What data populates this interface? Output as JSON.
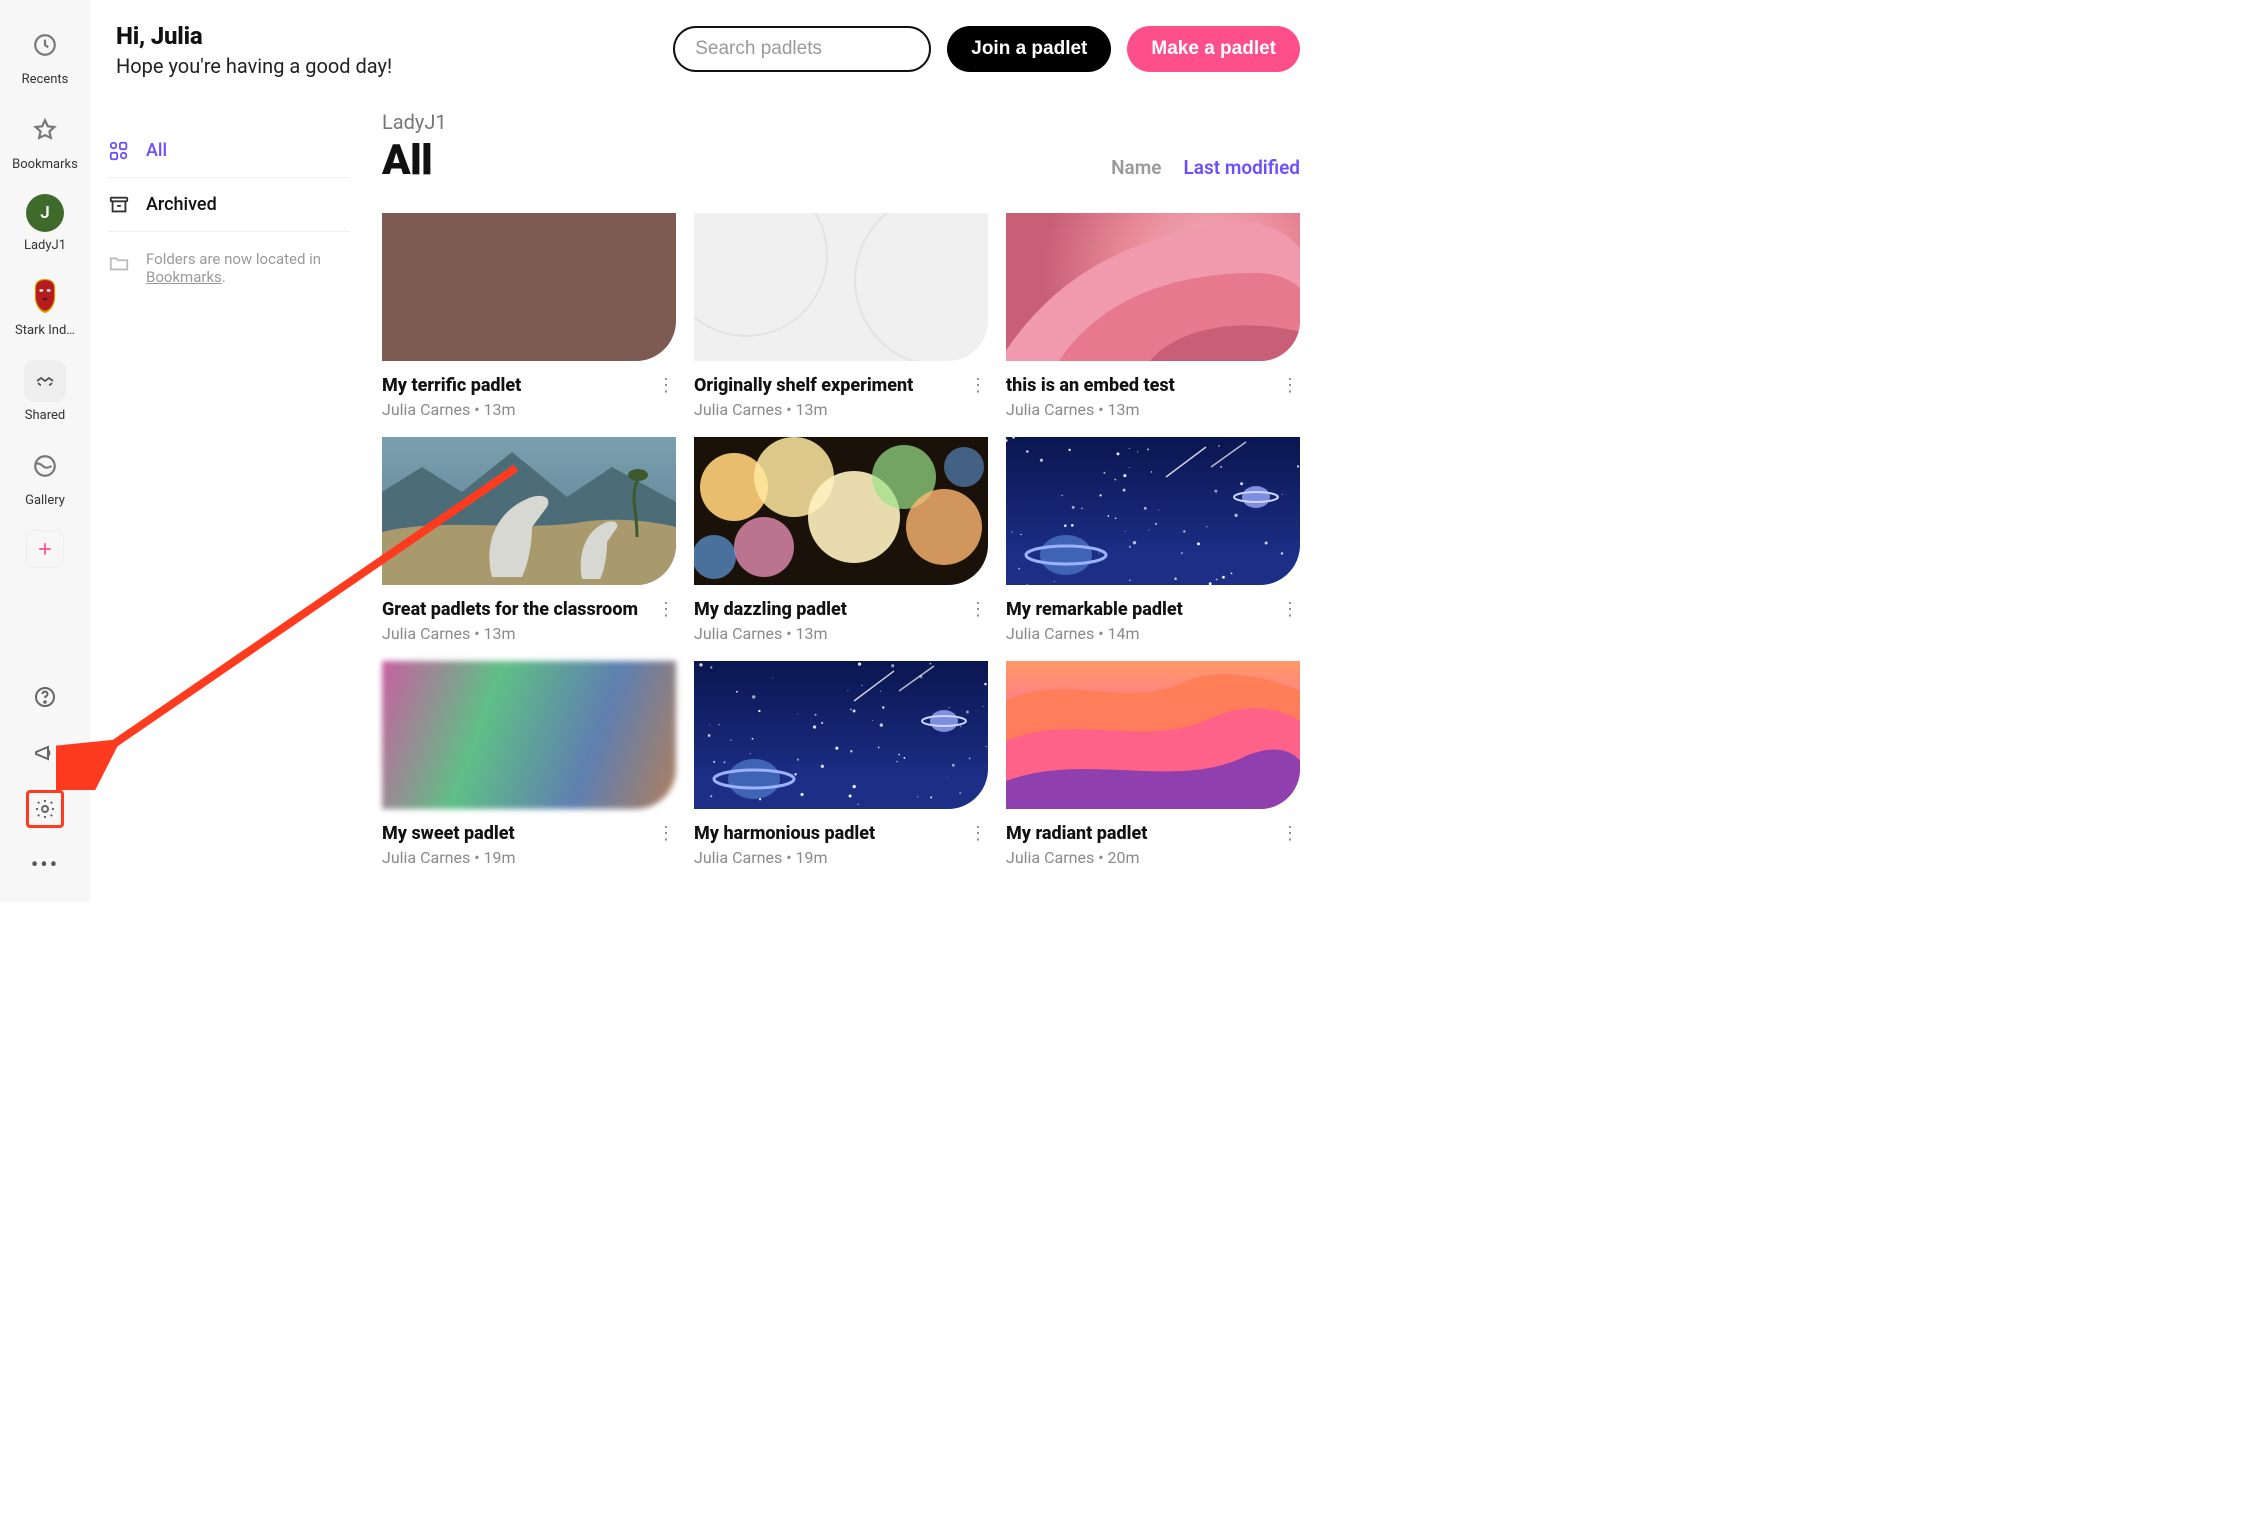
{
  "greet": {
    "hi": "Hi, Julia",
    "sub": "Hope you're having a good day!"
  },
  "search": {
    "placeholder": "Search padlets"
  },
  "buttons": {
    "join": "Join a padlet",
    "make": "Make a padlet"
  },
  "rail": {
    "recents": "Recents",
    "bookmarks": "Bookmarks",
    "ladyj": "LadyJ1",
    "ladyj_initial": "J",
    "stark": "Stark Ind…",
    "shared": "Shared",
    "gallery": "Gallery"
  },
  "nav2": {
    "all": "All",
    "archived": "Archived",
    "note1": "Folders are now located in ",
    "note_link": "Bookmarks",
    "note_period": "."
  },
  "breadcrumb": "LadyJ1",
  "heading": "All",
  "sort": {
    "name": "Name",
    "modified": "Last modified"
  },
  "cards": [
    {
      "title": "My terrific padlet",
      "meta": "Julia Carnes • 13m",
      "thumb": "brown"
    },
    {
      "title": "Originally shelf experiment",
      "meta": "Julia Carnes • 13m",
      "thumb": "gray"
    },
    {
      "title": "this is an embed test",
      "meta": "Julia Carnes • 13m",
      "thumb": "rose"
    },
    {
      "title": "Great padlets for the classroom",
      "meta": "Julia Carnes • 13m",
      "thumb": "dino"
    },
    {
      "title": "My dazzling padlet",
      "meta": "Julia Carnes • 13m",
      "thumb": "bokeh"
    },
    {
      "title": "My remarkable padlet",
      "meta": "Julia Carnes • 14m",
      "thumb": "space"
    },
    {
      "title": "My sweet padlet",
      "meta": "Julia Carnes • 19m",
      "thumb": "blur"
    },
    {
      "title": "My harmonious padlet",
      "meta": "Julia Carnes • 19m",
      "thumb": "space"
    },
    {
      "title": "My radiant padlet",
      "meta": "Julia Carnes • 20m",
      "thumb": "canyon"
    }
  ]
}
